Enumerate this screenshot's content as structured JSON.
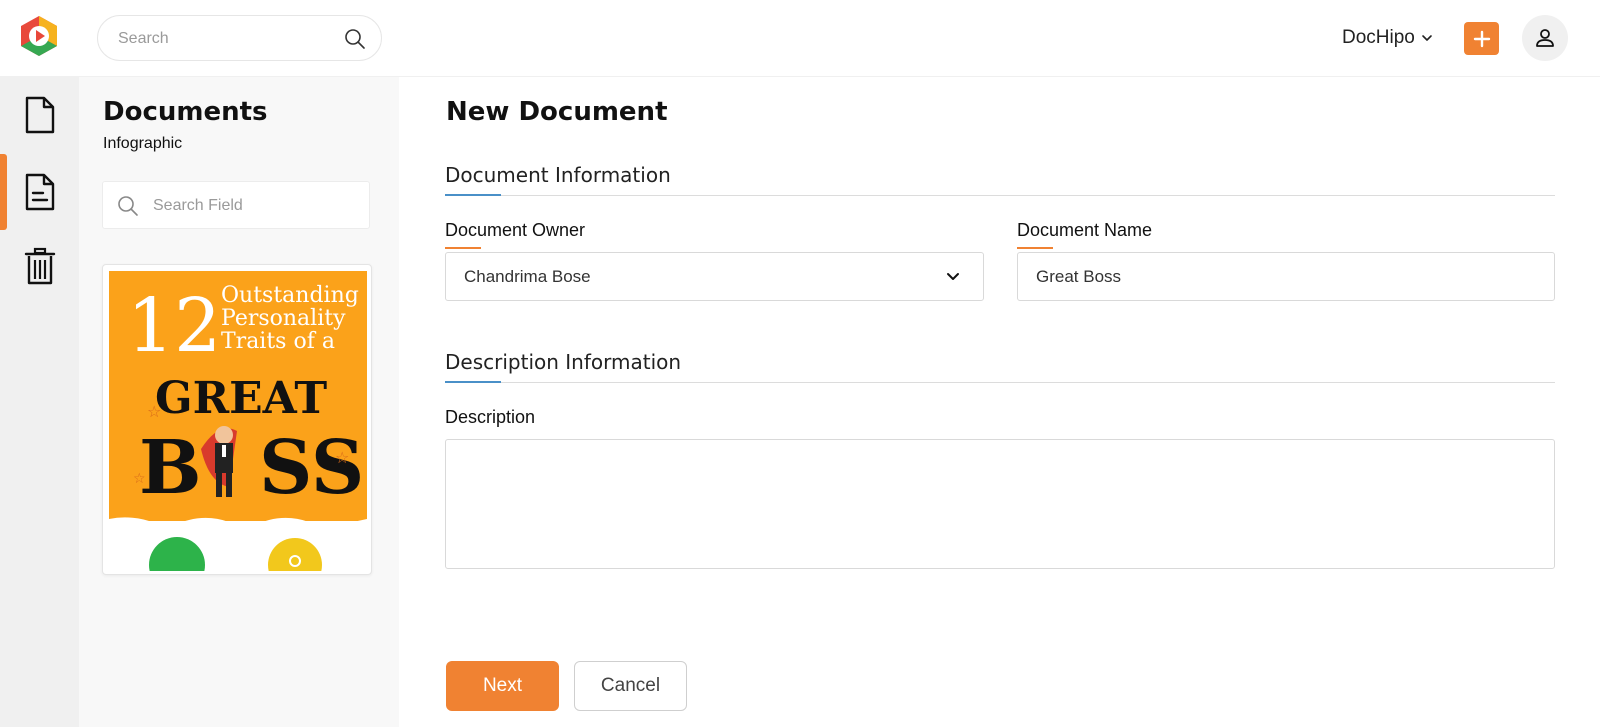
{
  "header": {
    "search_placeholder": "Search",
    "account_name": "DocHipo",
    "brand_color": "#f08232"
  },
  "rail": {
    "items": [
      {
        "icon": "document-icon",
        "active": false
      },
      {
        "icon": "document-text-icon",
        "active": true
      },
      {
        "icon": "trash-icon",
        "active": false
      }
    ]
  },
  "documents_panel": {
    "title": "Documents",
    "subtitle": "Infographic",
    "search_placeholder": "Search Field",
    "thumbnail": {
      "number": "12",
      "line1": "Outstanding",
      "line2": "Personality",
      "line3": "Traits of a",
      "word1": "GREAT",
      "word2_a": "B",
      "word2_b": "SS",
      "background_color": "#fba21a"
    }
  },
  "form": {
    "page_title": "New Document",
    "section1_title": "Document Information",
    "owner_label": "Document Owner",
    "owner_value": "Chandrima Bose",
    "name_label": "Document Name",
    "name_value": "Great Boss",
    "section2_title": "Description Information",
    "description_label": "Description",
    "description_value": "",
    "next_label": "Next",
    "cancel_label": "Cancel"
  }
}
